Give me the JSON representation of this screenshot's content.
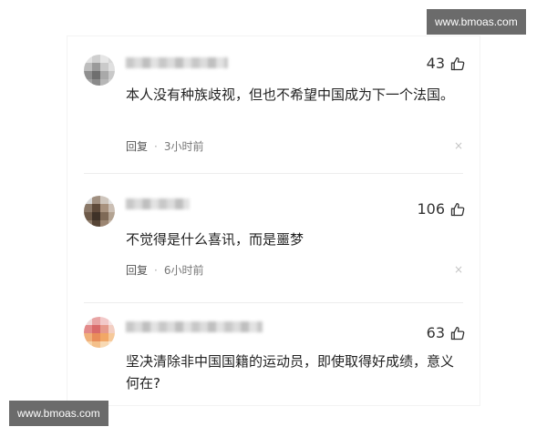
{
  "watermark": {
    "text": "www.bmoas.com"
  },
  "comments": [
    {
      "likes": "43",
      "text": "本人没有种族歧视，但也不希望中国成为下一个法国。",
      "reply_label": "回复",
      "separator": "·",
      "time": "3小时前",
      "dismiss": "×"
    },
    {
      "likes": "106",
      "text": "不觉得是什么喜讯，而是噩梦",
      "reply_label": "回复",
      "separator": "·",
      "time": "6小时前",
      "dismiss": "×"
    },
    {
      "likes": "63",
      "text": "坚决清除非中国国籍的运动员，即使取得好成绩，意义何在?",
      "reply_label": "",
      "separator": "",
      "time": "",
      "dismiss": ""
    }
  ],
  "icons": {
    "like": "thumbs-up-icon",
    "dismiss": "close-icon"
  }
}
